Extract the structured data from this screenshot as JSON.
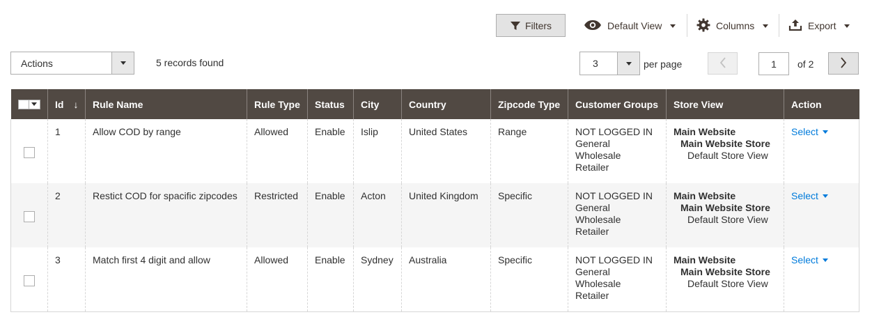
{
  "toolbar": {
    "filters_label": "Filters",
    "view_label": "Default View",
    "columns_label": "Columns",
    "export_label": "Export"
  },
  "actions": {
    "label": "Actions"
  },
  "records_found": "5 records found",
  "pagination": {
    "per_page_value": "3",
    "per_page_label": "per page",
    "current_page": "1",
    "of_label": "of 2"
  },
  "grid": {
    "headers": {
      "id": "Id",
      "sort_arrow": "↓",
      "rule_name": "Rule Name",
      "rule_type": "Rule Type",
      "status": "Status",
      "city": "City",
      "country": "Country",
      "zipcode_type": "Zipcode Type",
      "customer_groups": "Customer Groups",
      "store_view": "Store View",
      "action": "Action"
    },
    "rows": [
      {
        "id": "1",
        "rule_name": "Allow COD by range",
        "rule_type": "Allowed",
        "status": "Enable",
        "city": "Islip",
        "country": "United States",
        "zipcode_type": "Range",
        "groups": [
          "NOT LOGGED IN",
          "General",
          "Wholesale",
          "Retailer"
        ],
        "store": [
          "Main Website",
          "Main Website Store",
          "Default Store View"
        ],
        "action": "Select"
      },
      {
        "id": "2",
        "rule_name": "Restict COD for spacific zipcodes",
        "rule_type": "Restricted",
        "status": "Enable",
        "city": "Acton",
        "country": "United Kingdom",
        "zipcode_type": "Specific",
        "groups": [
          "NOT LOGGED IN",
          "General",
          "Wholesale",
          "Retailer"
        ],
        "store": [
          "Main Website",
          "Main Website Store",
          "Default Store View"
        ],
        "action": "Select"
      },
      {
        "id": "3",
        "rule_name": "Match first 4 digit and allow",
        "rule_type": "Allowed",
        "status": "Enable",
        "city": "Sydney",
        "country": "Australia",
        "zipcode_type": "Specific",
        "groups": [
          "NOT LOGGED IN",
          "General",
          "Wholesale",
          "Retailer"
        ],
        "store": [
          "Main Website",
          "Main Website Store",
          "Default Store View"
        ],
        "action": "Select"
      }
    ]
  },
  "colors": {
    "header_bg": "#514943",
    "link": "#007bdb",
    "alt_row": "#f5f5f5"
  }
}
